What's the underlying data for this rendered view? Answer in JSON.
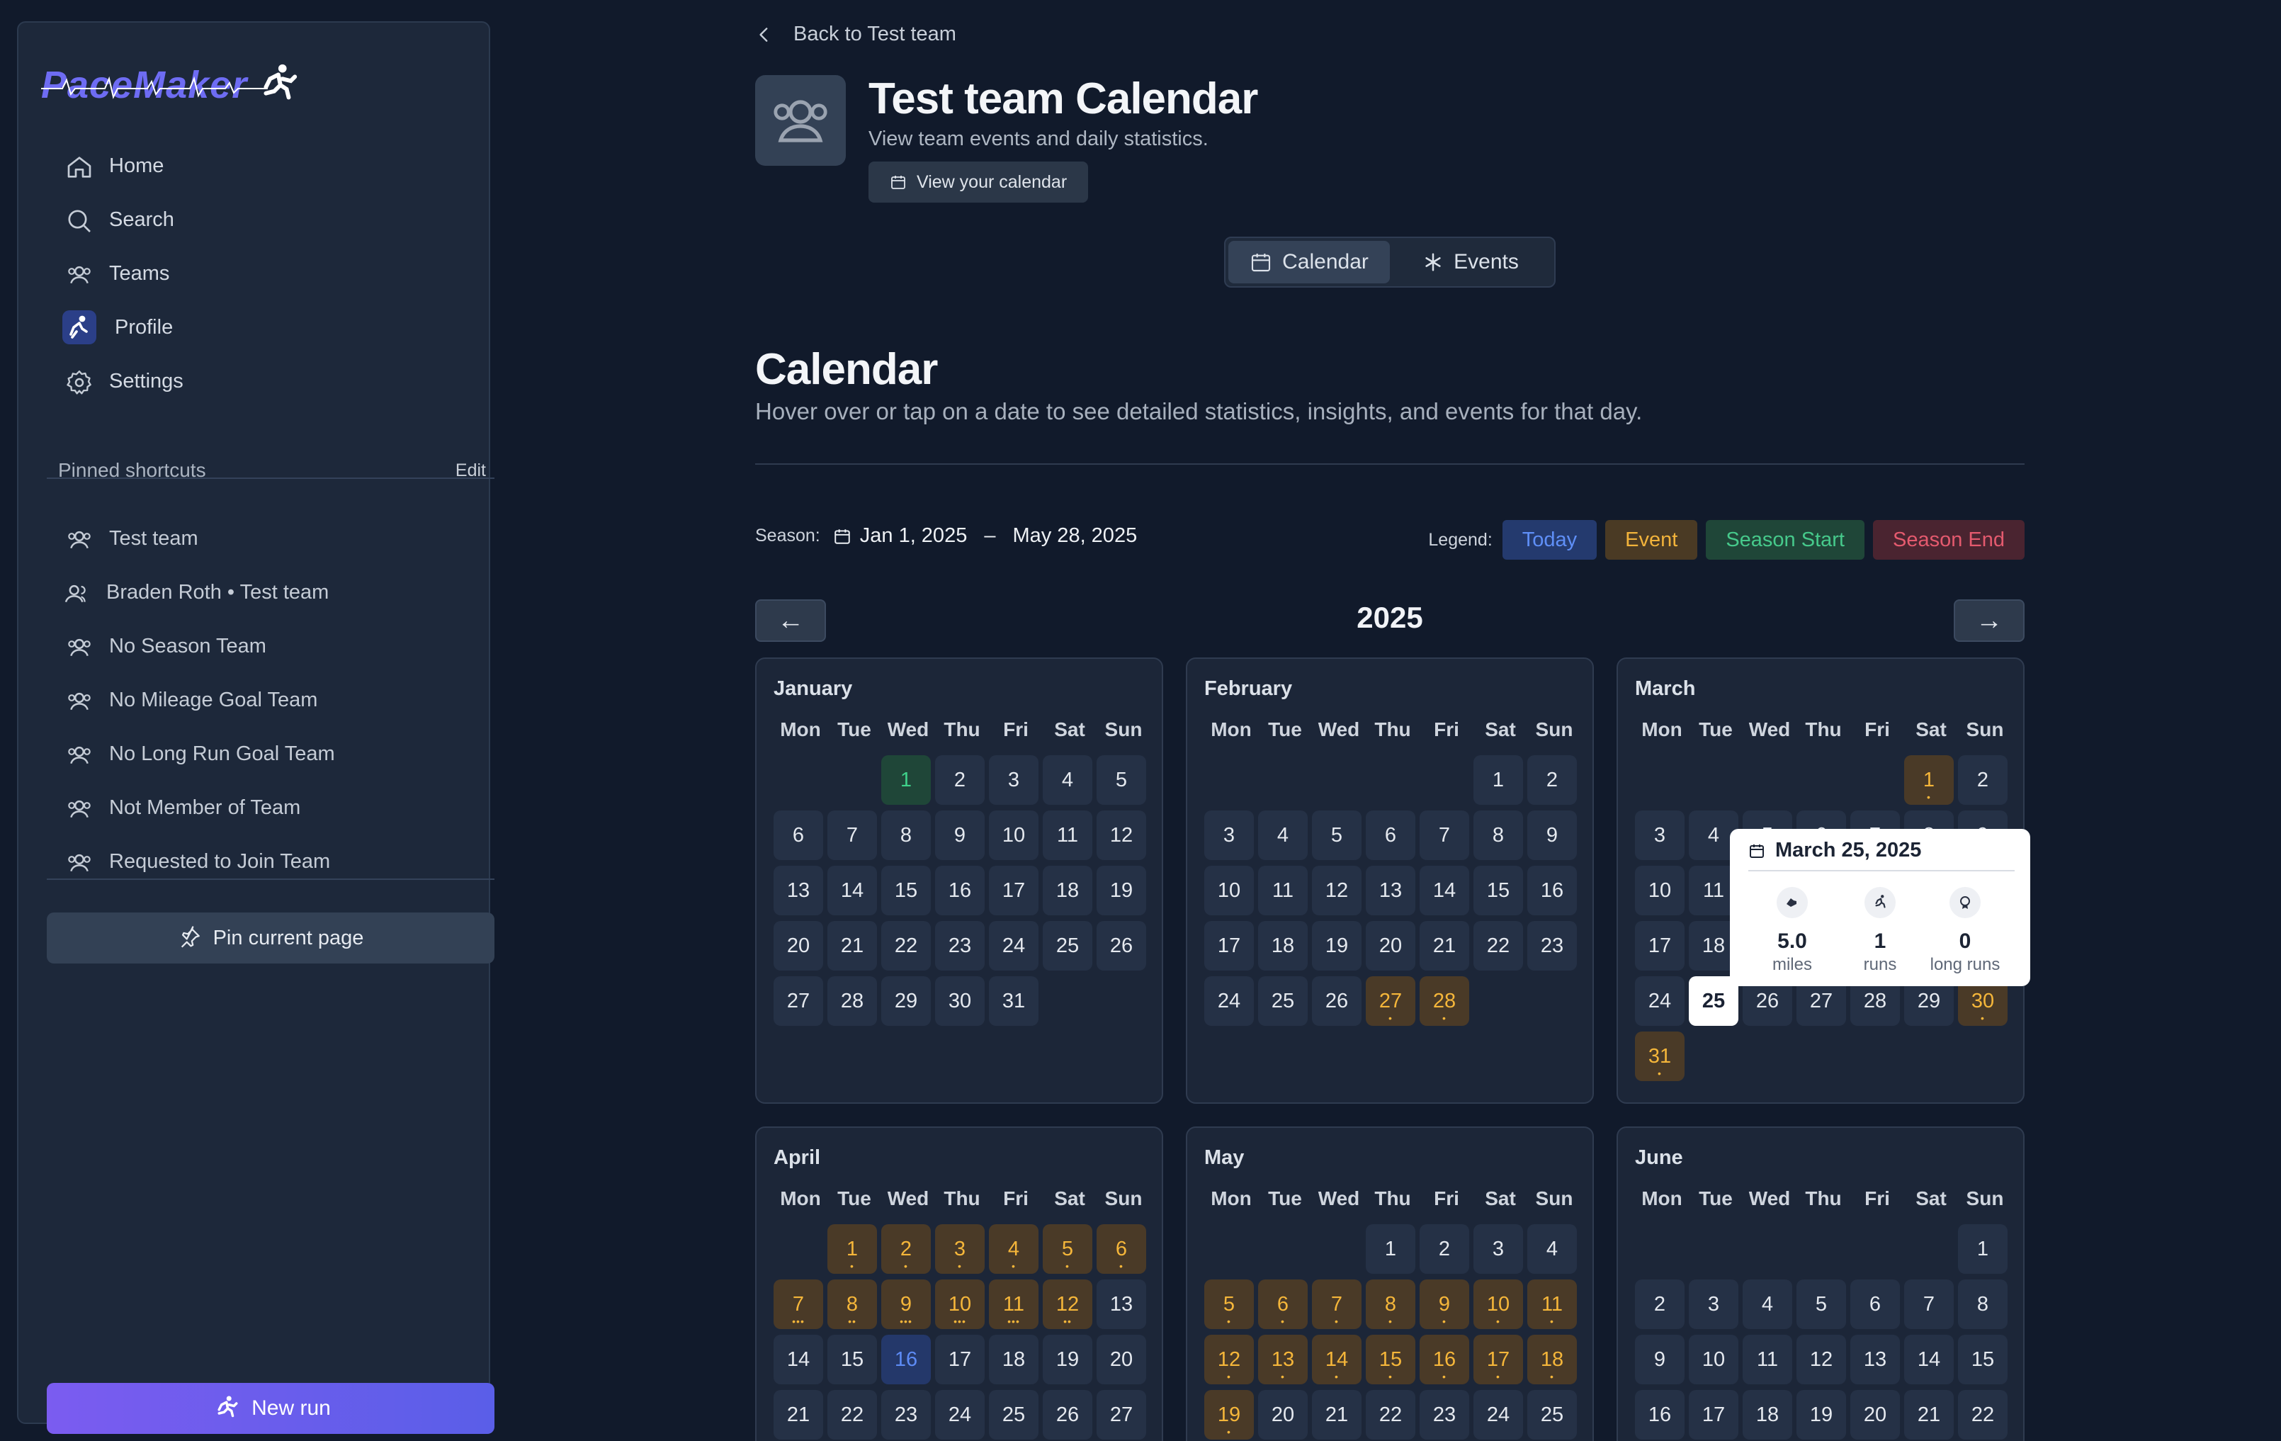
{
  "app": {
    "logo": "PaceMaker"
  },
  "nav": [
    {
      "label": "Home",
      "icon": "home-icon"
    },
    {
      "label": "Search",
      "icon": "search-icon"
    },
    {
      "label": "Teams",
      "icon": "users-icon"
    },
    {
      "label": "Profile",
      "icon": "avatar"
    },
    {
      "label": "Settings",
      "icon": "gear-icon"
    }
  ],
  "pinned": {
    "title": "Pinned shortcuts",
    "edit": "Edit",
    "items": [
      "Test team",
      "Braden Roth • Test team",
      "No Season Team",
      "No Mileage Goal Team",
      "No Long Run Goal Team",
      "Not Member of Team",
      "Requested to Join Team"
    ],
    "pin_button": "Pin current page"
  },
  "new_run": "New run",
  "header": {
    "back": "Back to Test team",
    "title": "Test team Calendar",
    "subtitle": "View team events and daily statistics.",
    "view_calendar": "View your calendar"
  },
  "tabs": [
    {
      "label": "Calendar",
      "active": true
    },
    {
      "label": "Events",
      "active": false
    }
  ],
  "calendar": {
    "heading": "Calendar",
    "description": "Hover over or tap on a date to see detailed statistics, insights, and events for that day.",
    "season_label": "Season:",
    "season_start": "Jan 1, 2025",
    "season_dash": "–",
    "season_end": "May 28, 2025",
    "legend_label": "Legend:",
    "legend": [
      {
        "label": "Today",
        "bg": "#243a6e",
        "fg": "#5f8ff7"
      },
      {
        "label": "Event",
        "bg": "#4a3a24",
        "fg": "#f2b33b"
      },
      {
        "label": "Season Start",
        "bg": "#1f4638",
        "fg": "#46c98b"
      },
      {
        "label": "Season End",
        "bg": "#4a2430",
        "fg": "#e45a6e"
      }
    ],
    "prev": "←",
    "next": "→",
    "year": "2025",
    "weekdays": [
      "Mon",
      "Tue",
      "Wed",
      "Thu",
      "Fri",
      "Sat",
      "Sun"
    ]
  },
  "months": [
    {
      "name": "January",
      "offset": 2,
      "days": 31,
      "start": [
        1
      ],
      "today": [],
      "selected": [],
      "events": {}
    },
    {
      "name": "February",
      "offset": 5,
      "days": 28,
      "start": [],
      "today": [],
      "selected": [],
      "events": {
        "27": 1,
        "28": 1
      }
    },
    {
      "name": "March",
      "offset": 5,
      "days": 31,
      "start": [],
      "today": [],
      "selected": [
        25
      ],
      "events": {
        "1": 1,
        "30": 1,
        "31": 1
      }
    },
    {
      "name": "April",
      "offset": 1,
      "days": 27,
      "start": [],
      "today": [
        16
      ],
      "selected": [],
      "events": {
        "1": 1,
        "2": 1,
        "3": 1,
        "4": 1,
        "5": 1,
        "6": 1,
        "7": 3,
        "8": 2,
        "9": 3,
        "10": 3,
        "11": 3,
        "12": 2
      }
    },
    {
      "name": "May",
      "offset": 3,
      "days": 25,
      "start": [],
      "today": [],
      "selected": [],
      "events": {
        "5": 1,
        "6": 1,
        "7": 1,
        "8": 1,
        "9": 1,
        "10": 1,
        "11": 1,
        "12": 1,
        "13": 1,
        "14": 1,
        "15": 1,
        "16": 1,
        "17": 1,
        "18": 1,
        "19": 1
      }
    },
    {
      "name": "June",
      "offset": 6,
      "days": 22,
      "start": [],
      "today": [],
      "selected": [],
      "events": {}
    }
  ],
  "tooltip": {
    "date": "March 25, 2025",
    "stats": [
      {
        "value": "5.0",
        "unit": "miles"
      },
      {
        "value": "1",
        "unit": "runs"
      },
      {
        "value": "0",
        "unit": "long runs"
      }
    ]
  }
}
